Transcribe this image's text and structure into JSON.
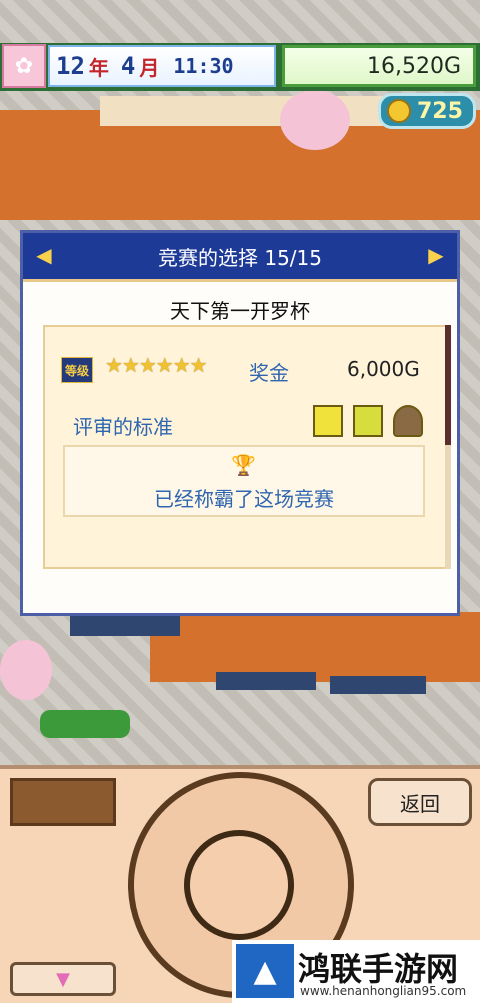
{
  "hud": {
    "year_num": "12",
    "year_unit": "年",
    "month_num": "4",
    "month_unit": "月",
    "time": "11:30",
    "money": "16,520G",
    "coins": "725"
  },
  "dialog": {
    "title": "竞赛的选择 15/15",
    "contest_name": "天下第一开罗杯",
    "rank_badge": "等级",
    "stars": "★★★★★★",
    "prize_label": "奖金",
    "prize_value": "6,000G",
    "criteria_label": "评审的标准",
    "result_text": "已经称霸了这场竞赛"
  },
  "controls": {
    "back_label": "返回",
    "down_glyph": "▼"
  },
  "watermark": {
    "title": "鸿联手游网",
    "url": "www.henanhonglian95.com"
  },
  "icons": {
    "blossom": "cherry-blossom-icon",
    "coin": "coin-icon",
    "trophy": "trophy-icon"
  }
}
